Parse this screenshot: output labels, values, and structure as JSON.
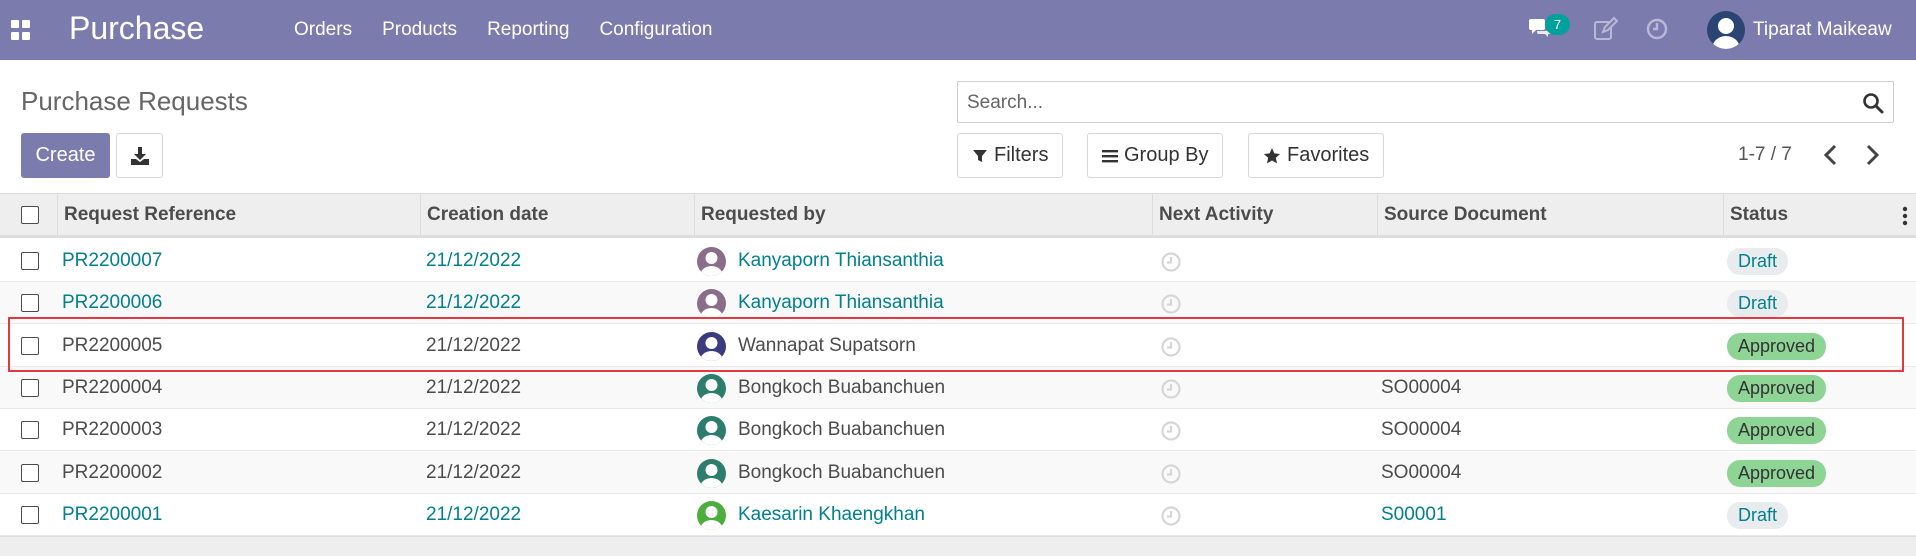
{
  "navbar": {
    "brand": "Purchase",
    "menu": [
      "Orders",
      "Products",
      "Reporting",
      "Configuration"
    ],
    "chat_count": "7",
    "user_name": "Tiparat Maikeaw",
    "color": "#7c7bad"
  },
  "control_panel": {
    "title": "Purchase Requests",
    "create_label": "Create",
    "search_placeholder": "Search...",
    "filters_label": "Filters",
    "group_by_label": "Group By",
    "favorites_label": "Favorites",
    "pager_value": "1-7 / 7"
  },
  "table": {
    "columns": [
      "Request Reference",
      "Creation date",
      "Requested by",
      "Next Activity",
      "Source Document",
      "Status"
    ],
    "rows": [
      {
        "reference": "PR2200007",
        "date": "21/12/2022",
        "requested_by": "Kanyaporn Thiansanthia",
        "source": "",
        "status": "Draft",
        "style": "link",
        "avatar": "#8a6d88"
      },
      {
        "reference": "PR2200006",
        "date": "21/12/2022",
        "requested_by": "Kanyaporn Thiansanthia",
        "source": "",
        "status": "Draft",
        "style": "link",
        "avatar": "#8a6d88"
      },
      {
        "reference": "PR2200005",
        "date": "21/12/2022",
        "requested_by": "Wannapat Supatsorn",
        "source": "",
        "status": "Approved",
        "style": "plain",
        "avatar": "#3a3c7e"
      },
      {
        "reference": "PR2200004",
        "date": "21/12/2022",
        "requested_by": "Bongkoch Buabanchuen",
        "source": "SO00004",
        "status": "Approved",
        "style": "plain",
        "avatar": "#2d7d6c"
      },
      {
        "reference": "PR2200003",
        "date": "21/12/2022",
        "requested_by": "Bongkoch Buabanchuen",
        "source": "SO00004",
        "status": "Approved",
        "style": "plain",
        "avatar": "#2d7d6c"
      },
      {
        "reference": "PR2200002",
        "date": "21/12/2022",
        "requested_by": "Bongkoch Buabanchuen",
        "source": "SO00004",
        "status": "Approved",
        "style": "plain",
        "avatar": "#2d7d6c"
      },
      {
        "reference": "PR2200001",
        "date": "21/12/2022",
        "requested_by": "Kaesarin Khaengkhan",
        "source": "S00001",
        "status": "Draft",
        "style": "link",
        "avatar": "#4cae3c"
      }
    ]
  },
  "colors": {
    "link": "#01808f",
    "approved_badge": "#8ed495",
    "draft_badge": "#e9ecef",
    "highlight": "#e2383f"
  }
}
